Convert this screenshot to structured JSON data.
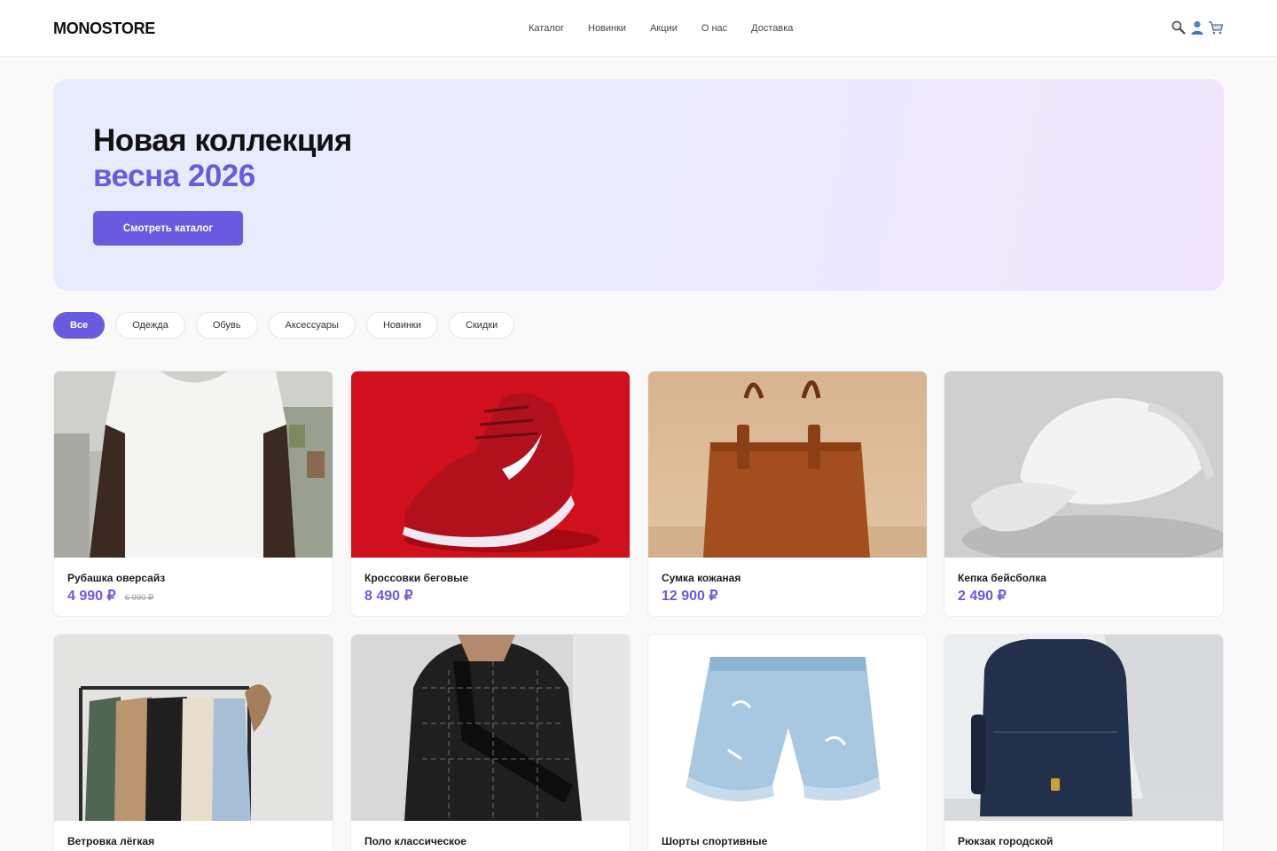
{
  "header": {
    "logo": "MONOSTORE",
    "nav": [
      "Каталог",
      "Новинки",
      "Акции",
      "О нас",
      "Доставка"
    ],
    "icons": [
      "search-icon",
      "user-icon",
      "cart-icon"
    ]
  },
  "hero": {
    "line1": "Новая коллекция",
    "line2": "весна 2026",
    "button": "Смотреть каталог"
  },
  "filters": [
    "Все",
    "Одежда",
    "Обувь",
    "Аксессуары",
    "Новинки",
    "Скидки"
  ],
  "products": [
    {
      "name": "Рубашка оверсайз",
      "price": "4 990 ₽",
      "old_price": "6 990 ₽",
      "image": "white t-shirt"
    },
    {
      "name": "Кроссовки беговые",
      "price": "8 490 ₽",
      "old_price": "",
      "image": "red running sneaker"
    },
    {
      "name": "Сумка кожаная",
      "price": "12 900 ₽",
      "old_price": "",
      "image": "brown leather tote bag"
    },
    {
      "name": "Кепка бейсболка",
      "price": "2 490 ₽",
      "old_price": "",
      "image": "white baseball cap"
    },
    {
      "name": "Ветровка лёгкая",
      "price": "",
      "old_price": "",
      "image": "jackets on clothing rack"
    },
    {
      "name": "Поло классическое",
      "price": "",
      "old_price": "",
      "image": "black patterned windbreaker"
    },
    {
      "name": "Шорты спортивные",
      "price": "",
      "old_price": "",
      "image": "denim shorts"
    },
    {
      "name": "Рюкзак городской",
      "price": "",
      "old_price": "",
      "image": "navy backpack"
    }
  ],
  "colors": {
    "accent": "#6a5ae0",
    "background": "#f9f9fa",
    "hero_from": "#e6ecfc",
    "hero_to": "#efe6fb"
  }
}
